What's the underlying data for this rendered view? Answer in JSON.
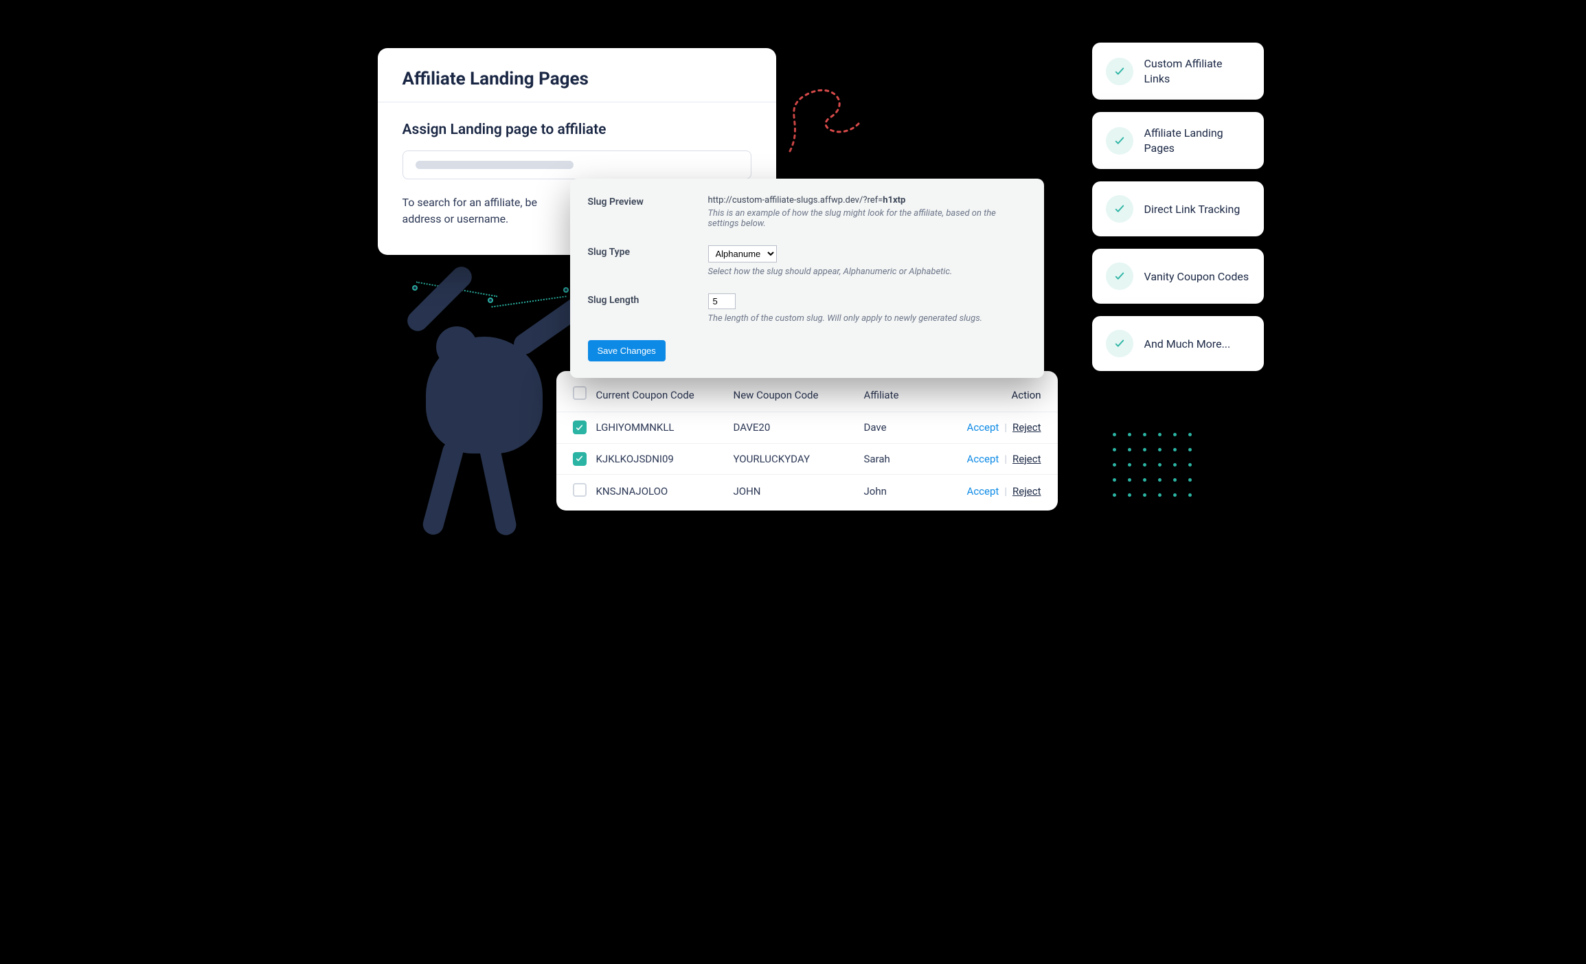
{
  "landing": {
    "title": "Affiliate Landing Pages",
    "subtitle": "Assign Landing page to affiliate",
    "hint": "To search for an affiliate, be­gin typing their email address or username."
  },
  "slug": {
    "preview_label": "Slug Preview",
    "preview_url_prefix": "http://custom-affiliate-slugs.affwp.dev/?ref=",
    "preview_url_bold": "h1xtp",
    "preview_desc": "This is an example of how the slug might look for the affiliate, based on the settings below.",
    "type_label": "Slug Type",
    "type_value": "Alphanumeric",
    "type_desc": "Select how the slug should appear, Alphanumeric or Alphabetic.",
    "length_label": "Slug Length",
    "length_value": "5",
    "length_desc": "The length of the custom slug. Will only apply to newly generated slugs.",
    "save": "Save Changes"
  },
  "table": {
    "headers": {
      "current": "Current Coupon Code",
      "new": "New Coupon Code",
      "affiliate": "Affiliate",
      "action": "Action"
    },
    "accept": "Accept",
    "reject": "Reject",
    "rows": [
      {
        "checked": true,
        "current": "LGHIYOMMNKLL",
        "new": "DAVE20",
        "affiliate": "Dave"
      },
      {
        "checked": true,
        "current": "KJKLKOJSDNI09",
        "new": "YOURLUCKYDAY",
        "affiliate": "Sarah"
      },
      {
        "checked": false,
        "current": "KNSJNAJOLOO",
        "new": "JOHN",
        "affiliate": "John"
      }
    ]
  },
  "features": [
    "Custom Affiliate Links",
    "Affiliate Landing Pages",
    "Direct Link Tracking",
    "Vanity Coupon Codes",
    "And Much More..."
  ]
}
